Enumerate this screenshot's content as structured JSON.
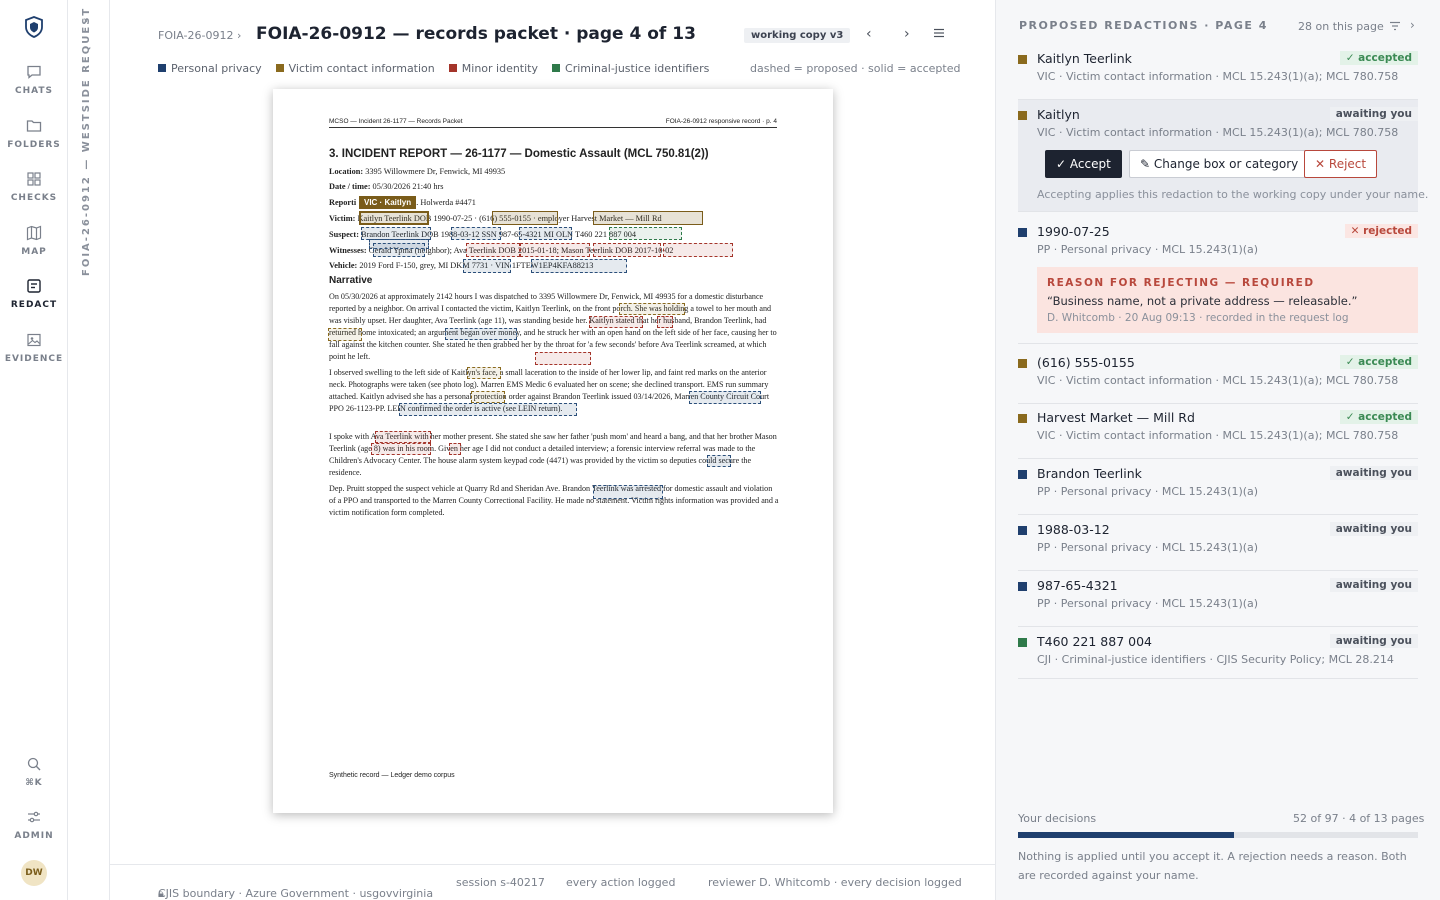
{
  "rail": {
    "items": [
      {
        "label": "CHATS",
        "icon": "chat-icon"
      },
      {
        "label": "FOLDERS",
        "icon": "folder-icon"
      },
      {
        "label": "CHECKS",
        "icon": "grid-icon"
      },
      {
        "label": "MAP",
        "icon": "map-icon"
      },
      {
        "label": "REDACT",
        "icon": "redact-icon"
      },
      {
        "label": "EVIDENCE",
        "icon": "image-icon"
      }
    ],
    "search_label": "⌘K",
    "admin_label": "ADMIN",
    "avatar": "DW"
  },
  "strip": {
    "text": "FOIA-26-0912 — WESTSIDE REQUEST"
  },
  "header": {
    "breadcrumb": "FOIA-26-0912 ›",
    "title": "FOIA-26-0912 — records packet · page 4 of 13",
    "working_copy": "working copy v3"
  },
  "legend": {
    "items": [
      {
        "label": "Personal privacy",
        "color": "#1f3f6e"
      },
      {
        "label": "Victim contact information",
        "color": "#8a6a1e"
      },
      {
        "label": "Minor identity",
        "color": "#a4342a"
      },
      {
        "label": "Criminal-justice identifiers",
        "color": "#2f7a4a"
      }
    ],
    "note": "dashed = proposed · solid = accepted"
  },
  "document": {
    "header_left": "MCSO — Incident 26-1177 — Records Packet",
    "header_right": "FOIA-26-0912 responsive record · p. 4",
    "title": "3. INCIDENT REPORT — 26-1177 — Domestic Assault (MCL 750.81(2))",
    "location_label": "Location:",
    "location": "3395 Willowmere Dr, Fenwick, MI 49935",
    "date_label": "Date / time:",
    "date": "05/30/2026 21:40 hrs",
    "reporting_label": "Reporti",
    "reporting": "A. Holwerda #4471",
    "victim_label": "Victim:",
    "victim": "Kaitlyn Teerlink DOB 1990-07-25 · (616) 555-0155 · employer Harvest Market — Mill Rd",
    "suspect_label": "Suspect:",
    "suspect": "Brandon Teerlink DOB 1988-03-12 SSN 987-65-4321 MI OLN T460 221 887 004",
    "witness_label": "Witnesses:",
    "witnesses": "Gerald Ypma (neighbor); Ava Teerlink DOB 2015-01-18; Mason Teerlink DOB 2017-10-02",
    "vehicle_label": "Vehicle:",
    "vehicle": "2019 Ford F-150, grey, MI DKM 7731 · VIN 1FTEW1EP4KFA88213",
    "narrative_heading": "Narrative",
    "para1": "On 05/30/2026 at approximately 2142 hours I was dispatched to 3395 Willowmere Dr, Fenwick, MI 49935 for a domestic disturbance reported by a neighbor. On arrival I contacted the victim, Kaitlyn Teerlink, on the front porch. She was holding a towel to her mouth and was visibly upset. Her daughter, Ava Teerlink (age 11), was standing beside her. Kaitlyn stated that her husband, Brandon Teerlink, had returned home intoxicated; an argument began over money, and he struck her with an open hand on the left side of her face, causing her to fall against the kitchen counter. She stated he then grabbed her by the throat for 'a few seconds' before Ava Teerlink screamed, at which point he left.",
    "para2": "I observed swelling to the left side of Kaitlyn's face, a small laceration to the inside of her lower lip, and faint red marks on the anterior neck. Photographs were taken (see photo log). Marren EMS Medic 6 evaluated her on scene; she declined transport. EMS run summary attached. Kaitlyn advised she has a personal protection order against Brandon Teerlink issued 03/14/2026, Marren County Circuit Court PPO 26-1123-PP. LEIN confirmed the order is active (see LEIN return).",
    "para3": "I spoke with Ava Teerlink with her mother present. She stated she saw her father 'push mom' and heard a bang, and that her brother Mason Teerlink (age 8) was in his room. Given her age I did not conduct a detailed interview; a forensic interview referral was made to the Children's Advocacy Center. The house alarm system keypad code (4471) was provided by the victim so deputies could secure the residence.",
    "para4": "Dep. Pruitt stopped the suspect vehicle at Quarry Rd and Sheridan Ave. Brandon Teerlink was arrested for domestic assault and violation of a PPO and transported to the Marren County Correctional Facility. He made no statement. Victim rights information was provided and a victim notification form completed.",
    "footer": "Synthetic record — Ledger demo corpus",
    "tooltip": "VIC · Kaitlyn"
  },
  "footer": {
    "boundary": "CJIS boundary · Azure Government · usgovvirginia",
    "session": "session s-40217",
    "logging": "every action logged",
    "reviewer": "reviewer D. Whitcomb · every decision logged"
  },
  "panel": {
    "heading": "PROPOSED REDACTIONS · PAGE 4",
    "count": "28 on this page",
    "items": [
      {
        "name": "Kaitlyn Teerlink",
        "meta": "VIC · Victim contact information · MCL 15.243(1)(a); MCL 780.758",
        "status": "✓ accepted",
        "color": "#8a6a1e"
      },
      {
        "name": "Kaitlyn",
        "meta": "VIC · Victim contact information · MCL 15.243(1)(a); MCL 780.758",
        "status": "awaiting you",
        "color": "#8a6a1e"
      },
      {
        "name": "1990-07-25",
        "meta": "PP · Personal privacy · MCL 15.243(1)(a)",
        "status": "✕ rejected",
        "color": "#1f3f6e"
      },
      {
        "name": "(616) 555-0155",
        "meta": "VIC · Victim contact information · MCL 15.243(1)(a); MCL 780.758",
        "status": "✓ accepted",
        "color": "#8a6a1e"
      },
      {
        "name": "Harvest Market — Mill Rd",
        "meta": "VIC · Victim contact information · MCL 15.243(1)(a); MCL 780.758",
        "status": "✓ accepted",
        "color": "#8a6a1e"
      },
      {
        "name": "Brandon Teerlink",
        "meta": "PP · Personal privacy · MCL 15.243(1)(a)",
        "status": "awaiting you",
        "color": "#1f3f6e"
      },
      {
        "name": "1988-03-12",
        "meta": "PP · Personal privacy · MCL 15.243(1)(a)",
        "status": "awaiting you",
        "color": "#1f3f6e"
      },
      {
        "name": "987-65-4321",
        "meta": "PP · Personal privacy · MCL 15.243(1)(a)",
        "status": "awaiting you",
        "color": "#1f3f6e"
      },
      {
        "name": "T460 221 887 004",
        "meta": "CJI · Criminal-justice identifiers · CJIS Security Policy; MCL 28.214",
        "status": "awaiting you",
        "color": "#2f7a4a"
      }
    ],
    "actions": {
      "accept": "Accept",
      "change": "Change box or category",
      "reject": "Reject"
    },
    "hint": "Accepting applies this redaction to the working copy under your name.",
    "reason": {
      "heading": "REASON FOR REJECTING — REQUIRED",
      "quote": "“Business name, not a private address — releasable.”",
      "meta": "D. Whitcomb · 20 Aug 09:13 · recorded in the request log"
    },
    "decisions_label": "Your decisions",
    "decisions_count": "52 of 97 · 4 of 13 pages",
    "progress": 0.54,
    "note": "Nothing is applied until you accept it. A rejection needs a reason. Both are recorded against your name."
  }
}
